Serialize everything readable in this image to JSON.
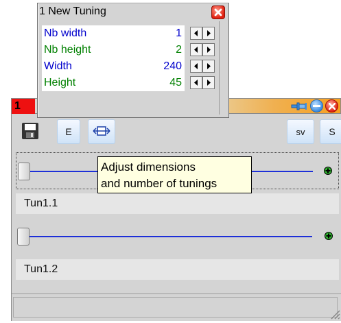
{
  "tuning_panel": {
    "title": "1  New Tuning",
    "rows": [
      {
        "label": "Nb width",
        "value": "1",
        "label_color": "#0000cc",
        "value_color": "#0000cc"
      },
      {
        "label": "Nb height",
        "value": "2",
        "label_color": "#008000",
        "value_color": "#008000"
      },
      {
        "label": "Width",
        "value": "240",
        "label_color": "#0000cc",
        "value_color": "#0000cc"
      },
      {
        "label": "Height",
        "value": "45",
        "label_color": "#008000",
        "value_color": "#008000"
      }
    ],
    "icons": {
      "decrement": "left-arrow-icon",
      "increment": "right-arrow-icon",
      "close": "close-icon"
    }
  },
  "main_window": {
    "number": "1",
    "toolbar": {
      "e_label": "E",
      "sv_label": "sv",
      "s_label": "S",
      "icons": [
        "save-icon",
        "resize-icon"
      ]
    },
    "tooltip": {
      "line1": "Adjust dimensions",
      "line2": "and number of tunings"
    },
    "tunings": [
      {
        "name": "Tun1.1"
      },
      {
        "name": "Tun1.2"
      }
    ],
    "title_icons": [
      "pin-icon",
      "minimize-icon",
      "close-icon"
    ]
  },
  "colors": {
    "accent_blue": "#1d2fd8",
    "title_orange": "#f7a020",
    "window_number_red": "#ee1010",
    "tooltip_bg": "#ffffe1"
  }
}
